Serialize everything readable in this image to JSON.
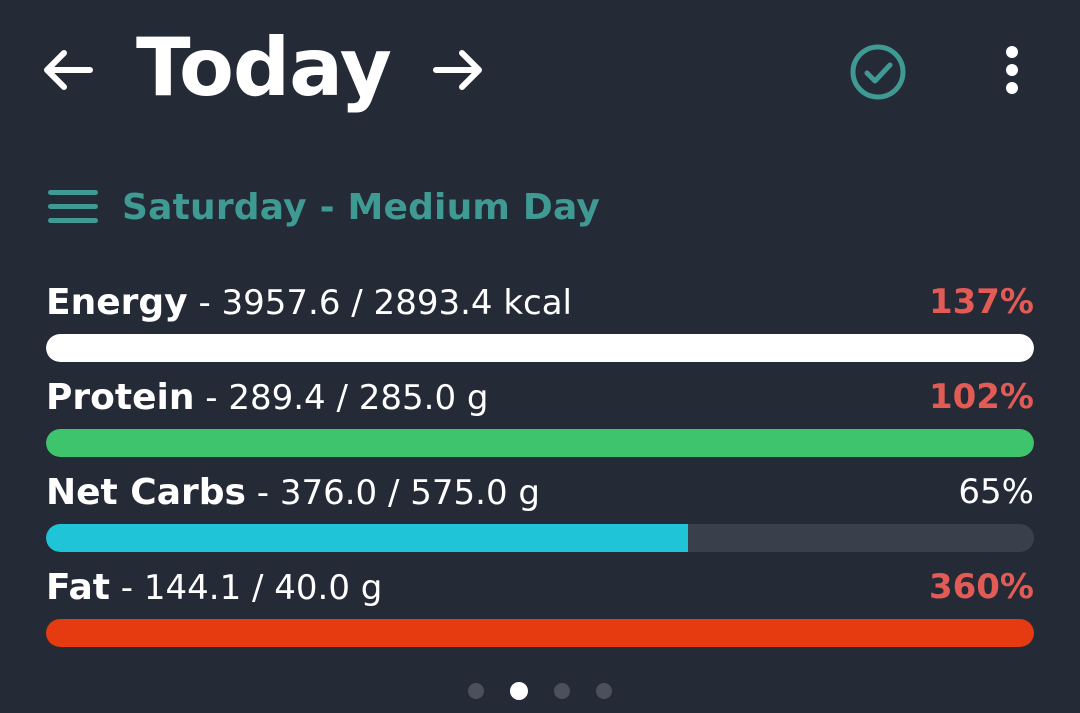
{
  "header": {
    "title": "Today",
    "prev_icon": "arrow-left-icon",
    "next_icon": "arrow-right-icon",
    "check_icon": "check-circle-icon",
    "more_icon": "more-vertical-icon"
  },
  "day": {
    "label": "Saturday - Medium Day",
    "menu_icon": "menu-icon"
  },
  "nutrients": [
    {
      "name": "Energy",
      "detail": " - 3957.6 / 2893.4 kcal",
      "percent": "137%",
      "fraction": 1.0,
      "color": "#ffffff",
      "over": true
    },
    {
      "name": "Protein",
      "detail": " - 289.4 / 285.0 g",
      "percent": "102%",
      "fraction": 1.0,
      "color": "#3ec46d",
      "over": true
    },
    {
      "name": "Net Carbs",
      "detail": " - 376.0 / 575.0 g",
      "percent": "65%",
      "fraction": 0.65,
      "color": "#1fc4d6",
      "over": false
    },
    {
      "name": "Fat",
      "detail": " - 144.1 / 40.0 g",
      "percent": "360%",
      "fraction": 1.0,
      "color": "#e63b10",
      "over": true
    }
  ],
  "colors": {
    "background": "#252a37",
    "accent": "#3f9a94",
    "over_target": "#e25b55",
    "track": "#3a3f4c"
  },
  "pager": {
    "count": 4,
    "active_index": 1
  }
}
